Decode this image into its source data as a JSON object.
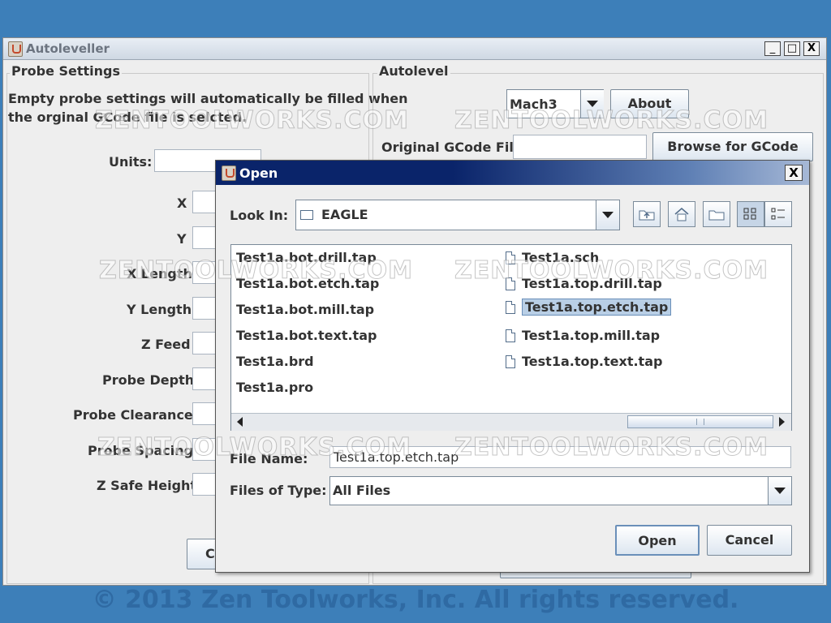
{
  "main_window": {
    "title": "Autoleveller",
    "controls": {
      "minimize": "_",
      "maximize": "□",
      "close": "X"
    }
  },
  "probe_settings": {
    "title": "Probe Settings",
    "note_line1": "Empty probe settings will automatically be filled when",
    "note_line2": "the orginal GCode file is selcted.",
    "fields": [
      {
        "label": "Units:",
        "value": ""
      },
      {
        "label": "X",
        "value": ""
      },
      {
        "label": "Y",
        "value": ""
      },
      {
        "label": "X Length",
        "value": ""
      },
      {
        "label": "Y Length",
        "value": ""
      },
      {
        "label": "Z Feed",
        "value": ""
      },
      {
        "label": "Probe Depth",
        "value": ""
      },
      {
        "label": "Probe Clearance",
        "value": ""
      },
      {
        "label": "Probe Spacing",
        "value": ""
      },
      {
        "label": "Z Safe Height",
        "value": ""
      }
    ],
    "bottom_button": "C"
  },
  "autolevel": {
    "title": "Autolevel",
    "controller_select": "Mach3",
    "about_button": "About",
    "gcode_label": "Original GCode File",
    "gcode_value": "",
    "browse_button": "Browse for GCode"
  },
  "open_dialog": {
    "title": "Open",
    "close": "X",
    "look_in_label": "Look In:",
    "look_in_value": "EAGLE",
    "toolbar_icons": [
      "up-folder-icon",
      "home-icon",
      "new-folder-icon",
      "list-view-icon",
      "details-view-icon"
    ],
    "files_col1": [
      "Test1a.bot.drill.tap",
      "Test1a.bot.etch.tap",
      "Test1a.bot.mill.tap",
      "Test1a.bot.text.tap",
      "Test1a.brd",
      "Test1a.pro"
    ],
    "files_col2": [
      "Test1a.sch",
      "Test1a.top.drill.tap",
      "Test1a.top.etch.tap",
      "Test1a.top.mill.tap",
      "Test1a.top.text.tap"
    ],
    "selected_file": "Test1a.top.etch.tap",
    "file_name_label": "File Name:",
    "file_name_value": "Test1a.top.etch.tap",
    "file_type_label": "Files of Type:",
    "file_type_value": "All Files",
    "open_button": "Open",
    "cancel_button": "Cancel"
  },
  "watermark": "ZENTOOLWORKS.COM",
  "copyright": "© 2013 Zen Toolworks, Inc. All rights reserved.",
  "colors": {
    "desktop": "#3d7fb9",
    "window_bg": "#eeeeee",
    "dialog_title": "#0a246a",
    "selection": "#b9cfe6"
  }
}
